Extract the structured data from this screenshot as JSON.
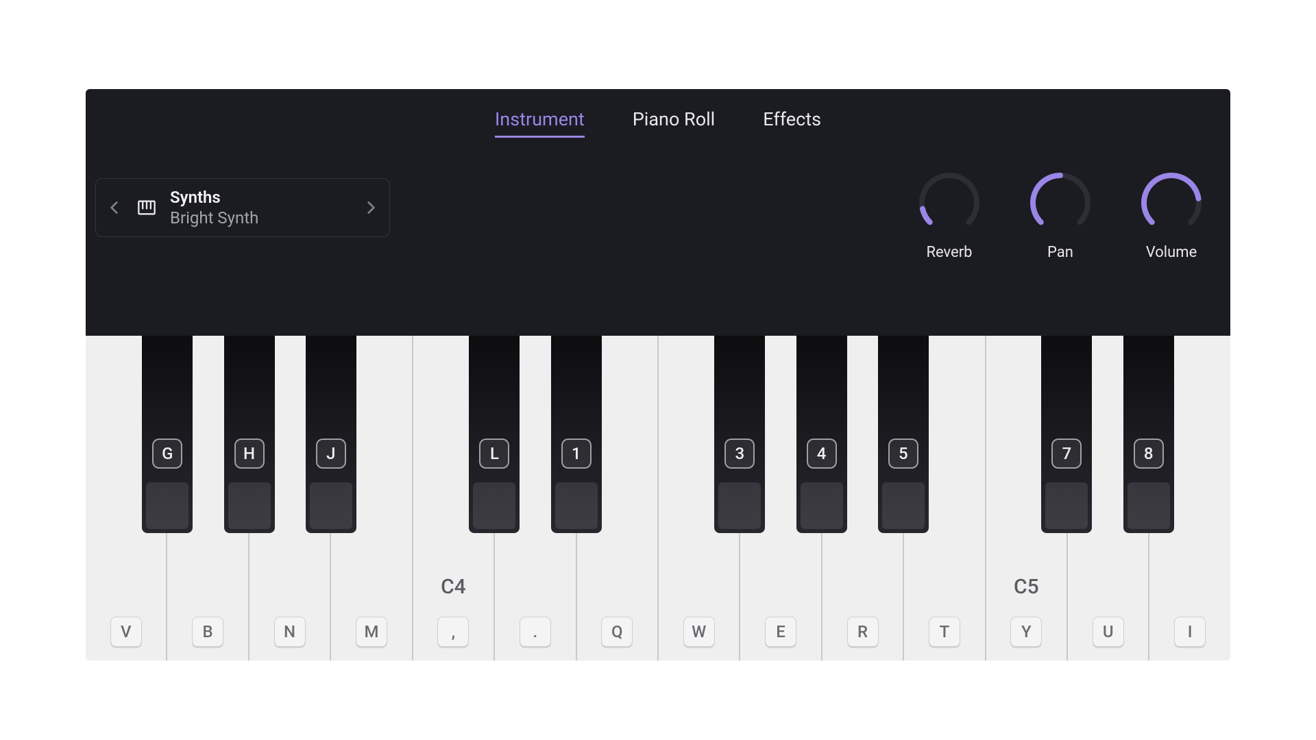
{
  "tabs": [
    {
      "label": "Instrument",
      "active": true
    },
    {
      "label": "Piano Roll",
      "active": false
    },
    {
      "label": "Effects",
      "active": false
    }
  ],
  "instrument_picker": {
    "category": "Synths",
    "name": "Bright Synth"
  },
  "knobs": [
    {
      "label": "Reverb",
      "value": 0.12
    },
    {
      "label": "Pan",
      "value": 0.5
    },
    {
      "label": "Volume",
      "value": 0.8
    }
  ],
  "white_keys": [
    {
      "kbd": "V",
      "note": ""
    },
    {
      "kbd": "B",
      "note": ""
    },
    {
      "kbd": "N",
      "note": ""
    },
    {
      "kbd": "M",
      "note": ""
    },
    {
      "kbd": ",",
      "note": "C4"
    },
    {
      "kbd": ".",
      "note": ""
    },
    {
      "kbd": "Q",
      "note": ""
    },
    {
      "kbd": "W",
      "note": ""
    },
    {
      "kbd": "E",
      "note": ""
    },
    {
      "kbd": "R",
      "note": ""
    },
    {
      "kbd": "T",
      "note": ""
    },
    {
      "kbd": "Y",
      "note": "C5"
    },
    {
      "kbd": "U",
      "note": ""
    },
    {
      "kbd": "I",
      "note": ""
    }
  ],
  "black_keys": [
    {
      "kbd": "G",
      "left_of_white_index": 1
    },
    {
      "kbd": "H",
      "left_of_white_index": 2
    },
    {
      "kbd": "J",
      "left_of_white_index": 3
    },
    {
      "kbd": "L",
      "left_of_white_index": 5
    },
    {
      "kbd": "1",
      "left_of_white_index": 6
    },
    {
      "kbd": "3",
      "left_of_white_index": 8
    },
    {
      "kbd": "4",
      "left_of_white_index": 9
    },
    {
      "kbd": "5",
      "left_of_white_index": 10
    },
    {
      "kbd": "7",
      "left_of_white_index": 12
    },
    {
      "kbd": "8",
      "left_of_white_index": 13
    }
  ],
  "colors": {
    "accent": "#9a86e6",
    "header_bg": "#1b1b22",
    "key_bg": "#efefef"
  }
}
